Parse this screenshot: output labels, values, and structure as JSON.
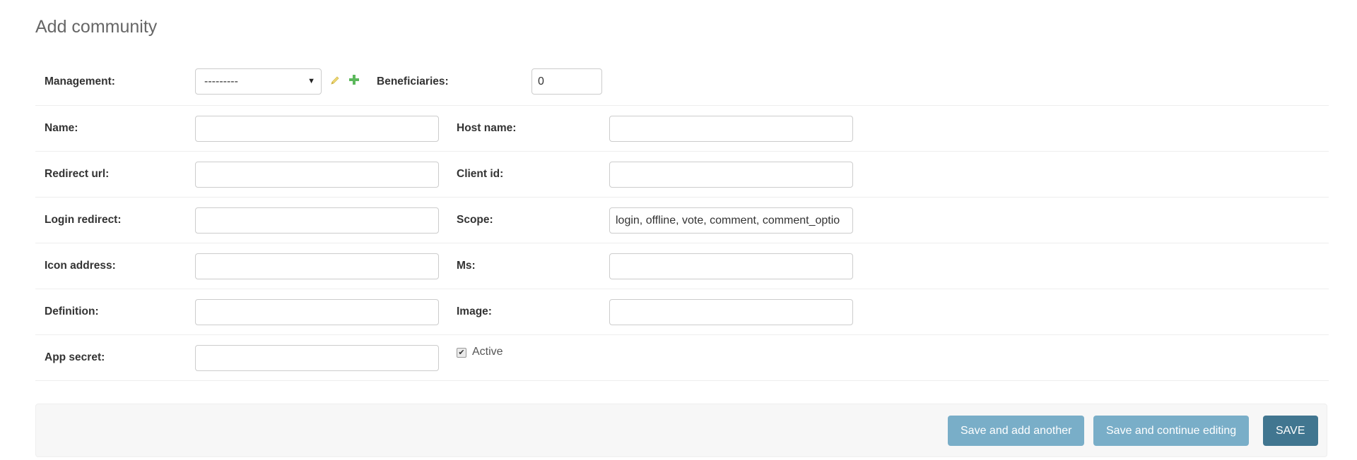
{
  "page": {
    "title": "Add community"
  },
  "form": {
    "management": {
      "label": "Management:",
      "selected": "---------"
    },
    "beneficiaries": {
      "label": "Beneficiaries:",
      "value": "0"
    },
    "name": {
      "label": "Name:",
      "value": ""
    },
    "host_name": {
      "label": "Host name:",
      "value": ""
    },
    "redirect_url": {
      "label": "Redirect url:",
      "value": ""
    },
    "client_id": {
      "label": "Client id:",
      "value": ""
    },
    "login_redirect": {
      "label": "Login redirect:",
      "value": ""
    },
    "scope": {
      "label": "Scope:",
      "value": "login, offline, vote, comment, comment_optio"
    },
    "icon_address": {
      "label": "Icon address:",
      "value": ""
    },
    "ms": {
      "label": "Ms:",
      "value": ""
    },
    "definition": {
      "label": "Definition:",
      "value": ""
    },
    "image": {
      "label": "Image:",
      "value": ""
    },
    "app_secret": {
      "label": "App secret:",
      "value": ""
    },
    "active": {
      "label": "Active",
      "checked": true
    }
  },
  "actions": {
    "save_add_another": "Save and add another",
    "save_continue": "Save and continue editing",
    "save": "SAVE"
  },
  "icons": {
    "edit": "pencil-icon",
    "add": "plus-icon"
  },
  "colors": {
    "primary_button": "#417690",
    "secondary_button": "#79aec8",
    "add_icon": "#5cb85c",
    "edit_icon": "#efd978"
  }
}
